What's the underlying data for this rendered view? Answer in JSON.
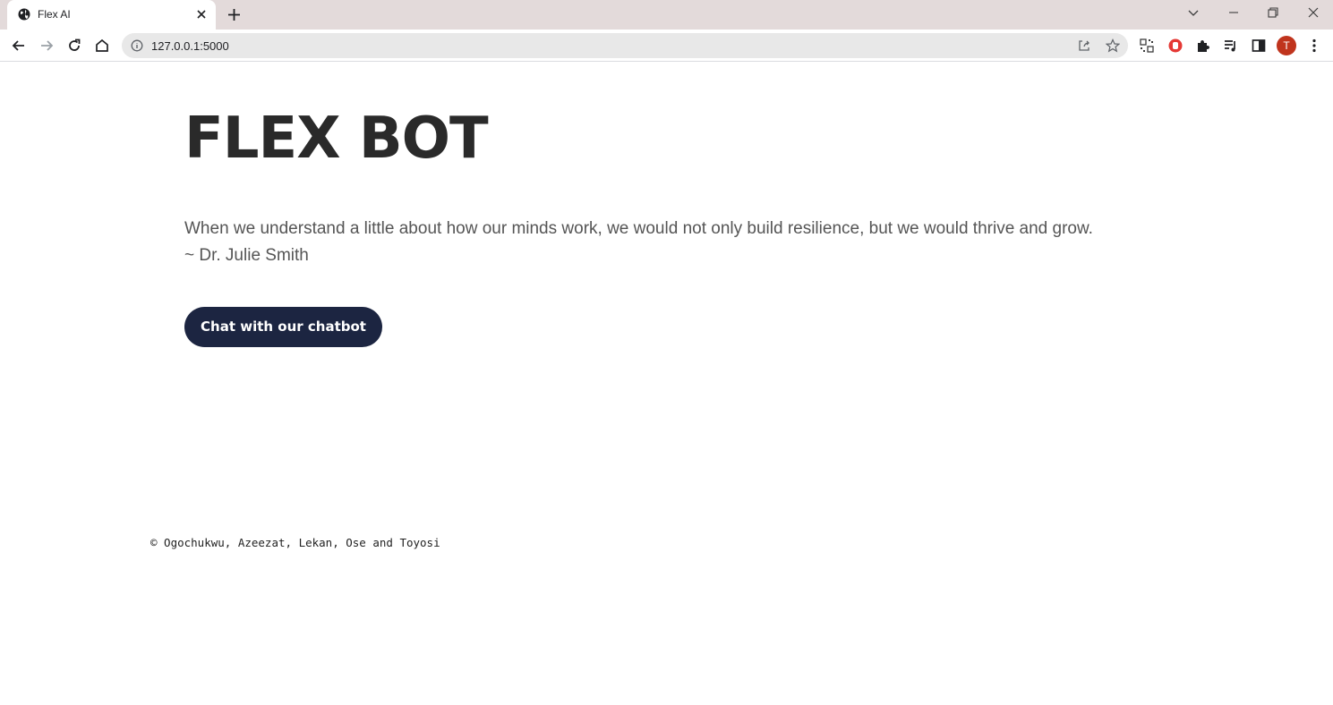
{
  "browser": {
    "tab": {
      "title": "Flex AI",
      "favicon": "globe-icon"
    },
    "address_bar": {
      "url": "127.0.0.1:5000"
    },
    "profile": {
      "initial": "T",
      "color": "#c0341d"
    }
  },
  "page": {
    "title": "FLEX BOT",
    "quote": {
      "text": "When we understand a little about how our minds work, we would not only build resilience, but we would thrive and grow.",
      "author": "~ Dr. Julie Smith"
    },
    "cta_label": "Chat with our chatbot",
    "footer": "© Ogochukwu, Azeezat, Lekan, Ose and Toyosi"
  },
  "colors": {
    "button_bg": "#1c2541",
    "title_text": "#2a2a2a",
    "tabstrip_bg": "#e3dada"
  }
}
